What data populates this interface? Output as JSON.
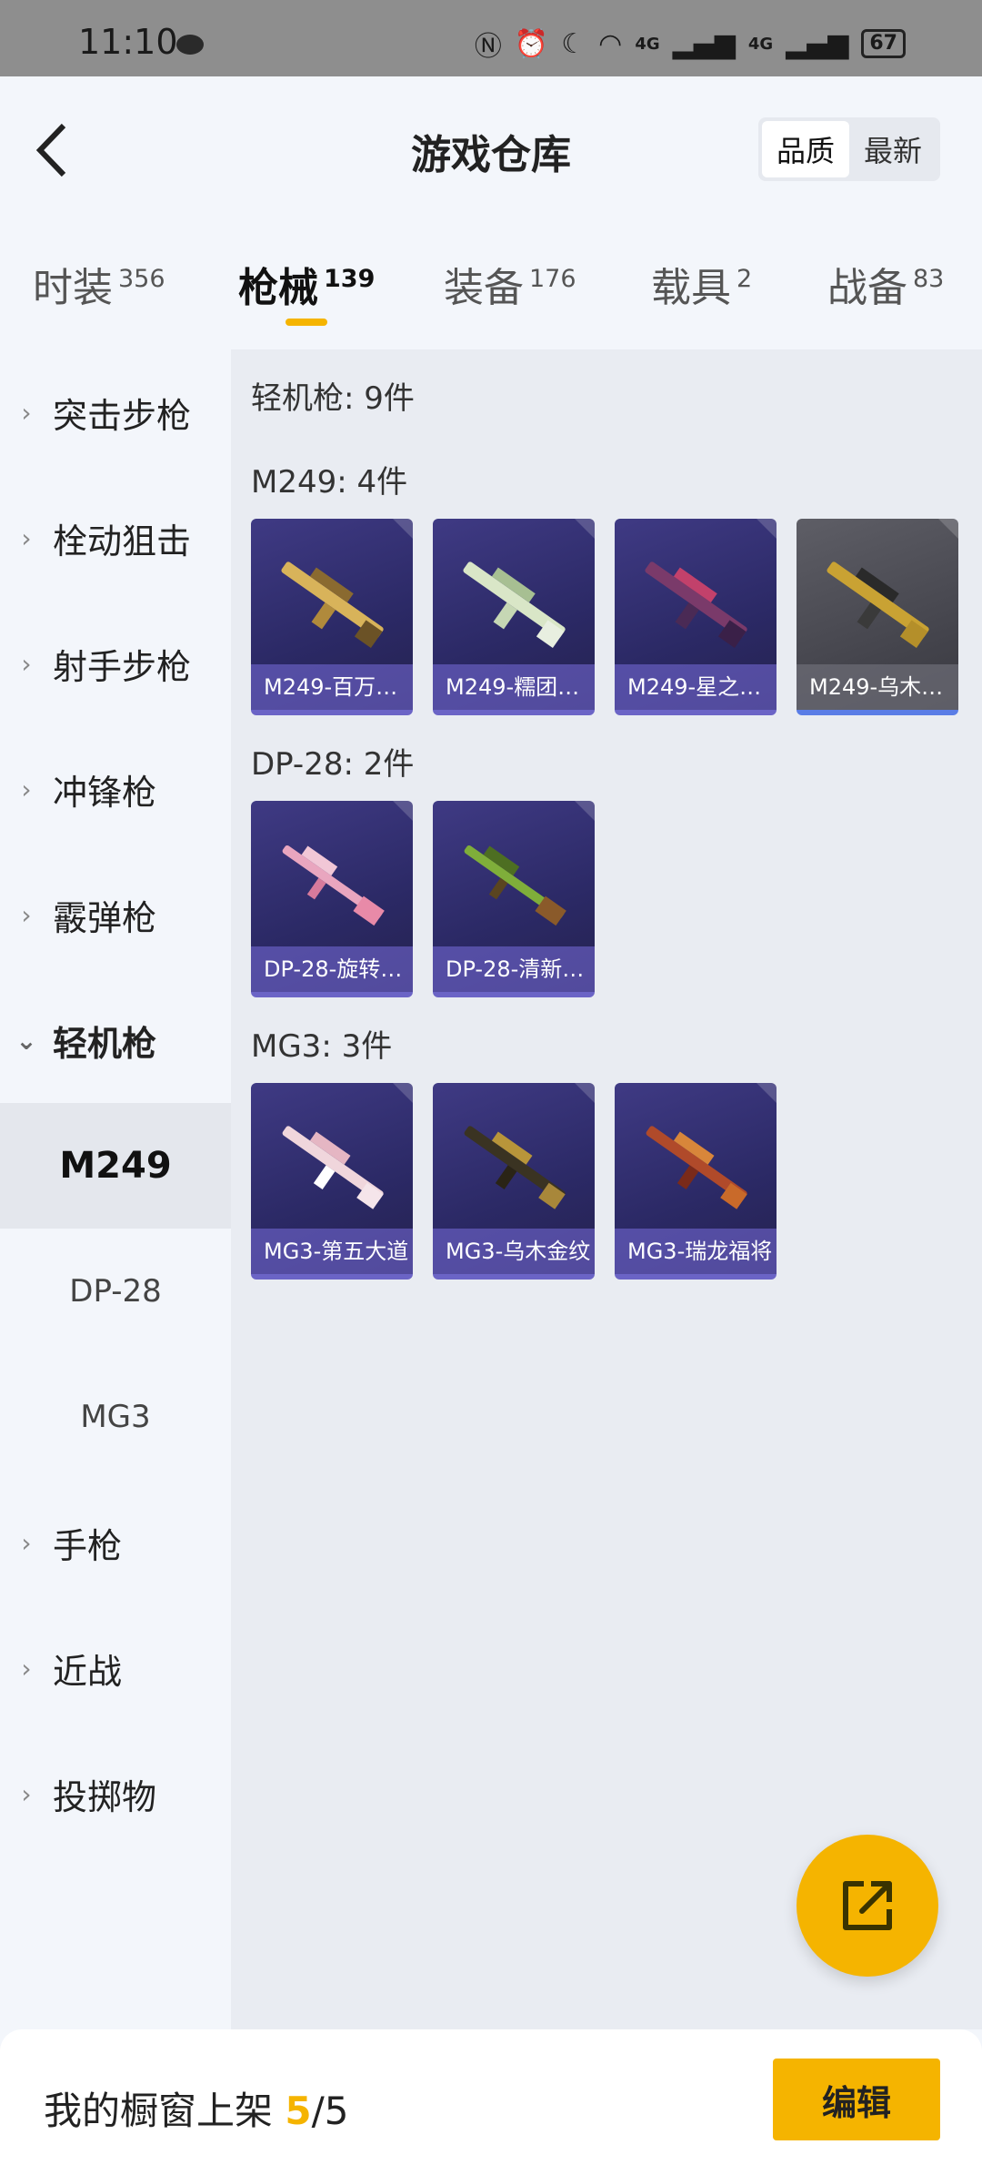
{
  "status_bar": {
    "time": "11:10",
    "battery": "67",
    "net1": "4G",
    "net2": "4G"
  },
  "header": {
    "title": "游戏仓库",
    "sort_options": [
      "品质",
      "最新"
    ]
  },
  "tabs": [
    {
      "label": "时装",
      "count": "356"
    },
    {
      "label": "枪械",
      "count": "139"
    },
    {
      "label": "装备",
      "count": "176"
    },
    {
      "label": "载具",
      "count": "2"
    },
    {
      "label": "战备",
      "count": "83"
    }
  ],
  "sidebar": {
    "items": [
      {
        "label": "突击步枪"
      },
      {
        "label": "栓动狙击"
      },
      {
        "label": "射手步枪"
      },
      {
        "label": "冲锋枪"
      },
      {
        "label": "霰弹枪"
      },
      {
        "label": "轻机枪"
      },
      {
        "label": "手枪"
      },
      {
        "label": "近战"
      },
      {
        "label": "投掷物"
      }
    ],
    "subitems": [
      {
        "label": "M249"
      },
      {
        "label": "DP-28"
      },
      {
        "label": "MG3"
      }
    ]
  },
  "content": {
    "summary": "轻机枪: 9件",
    "groups": [
      {
        "title": "M249: 4件",
        "items": [
          "M249-百万…",
          "M249-糯团…",
          "M249-星之…",
          "M249-乌木…"
        ]
      },
      {
        "title": "DP-28: 2件",
        "items": [
          "DP-28-旋转…",
          "DP-28-清新…"
        ]
      },
      {
        "title": "MG3: 3件",
        "items": [
          "MG3-第五大道",
          "MG3-乌木金纹",
          "MG3-瑞龙福将"
        ]
      }
    ]
  },
  "bottom_bar": {
    "label": "我的橱窗上架",
    "current": "5",
    "total": "/5",
    "edit_label": "编辑"
  },
  "colors": {
    "accent": "#f5b400",
    "card_purple": "#3f3a84",
    "card_grey": "#5e5e66"
  }
}
